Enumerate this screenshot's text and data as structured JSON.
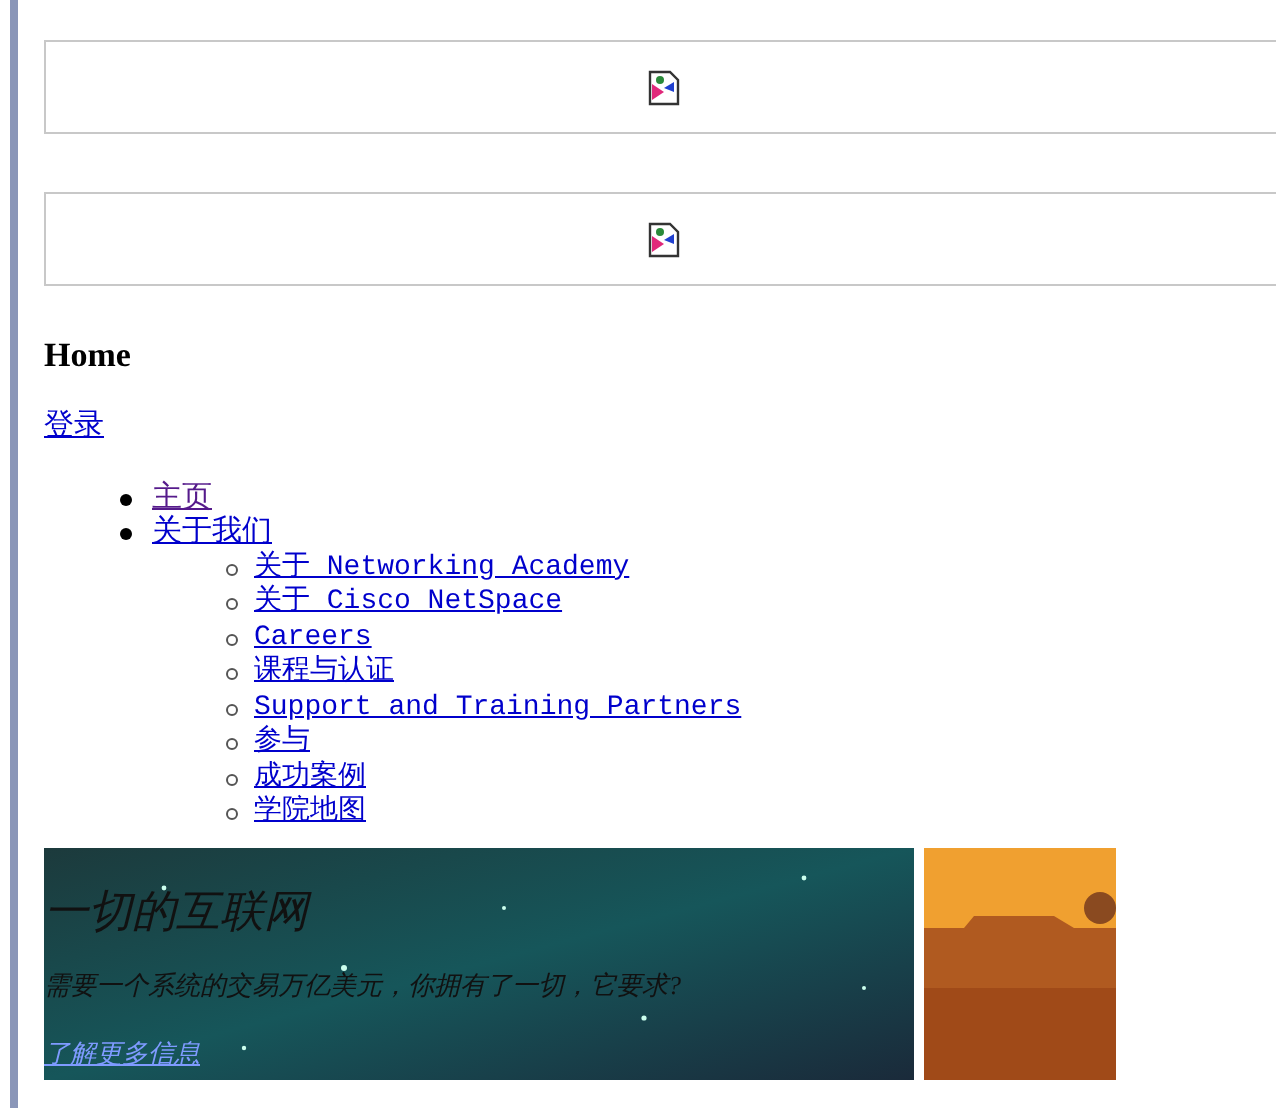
{
  "image_boxes": [
    {
      "kind": "broken_image"
    },
    {
      "kind": "broken_image"
    }
  ],
  "heading": "Home",
  "login_link": "登录",
  "nav": [
    {
      "label": "主页",
      "visited": true
    },
    {
      "label": "关于我们",
      "visited": false,
      "children": [
        {
          "label": "关于 Networking Academy",
          "visited": false
        },
        {
          "label": "关于 Cisco NetSpace",
          "visited": false
        },
        {
          "label": "Careers",
          "visited": false
        },
        {
          "label": "课程与认证",
          "visited": false
        },
        {
          "label": "Support and Training Partners",
          "visited": false
        },
        {
          "label": "参与",
          "visited": false
        },
        {
          "label": "成功案例",
          "visited": false
        },
        {
          "label": "学院地图",
          "visited": false
        }
      ]
    }
  ],
  "banner": {
    "title": "一切的互联网",
    "text": "需要一个系统的交易万亿美元，你拥有了一切，它要求?",
    "link": "了解更多信息"
  }
}
